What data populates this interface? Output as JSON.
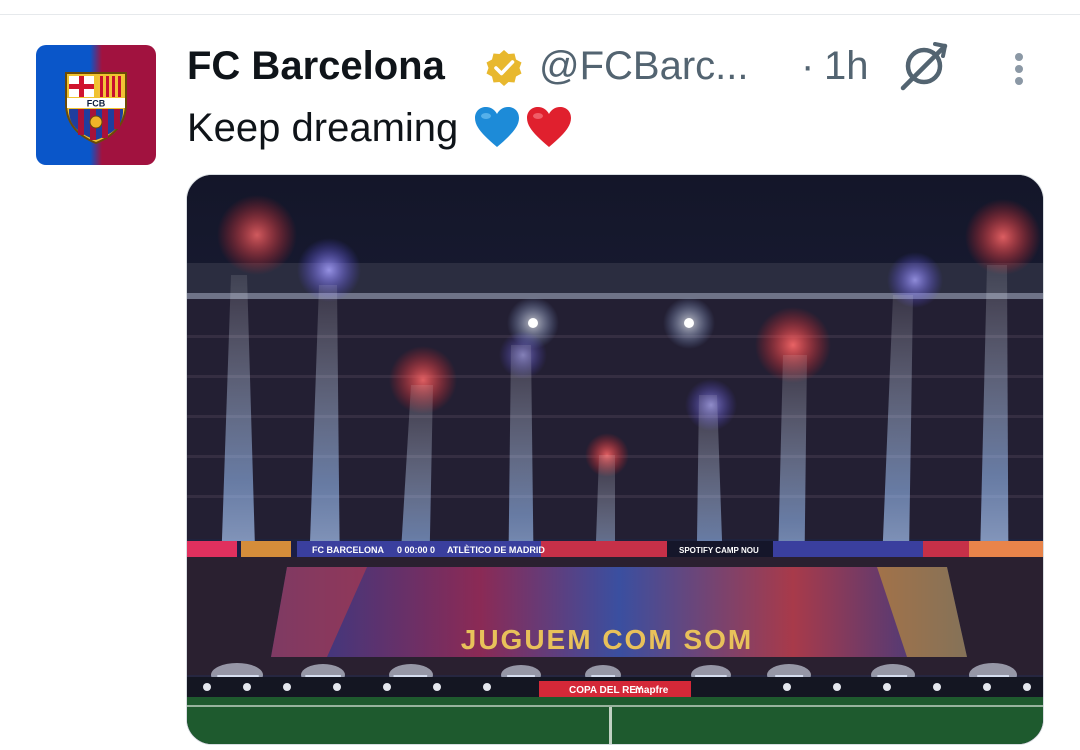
{
  "tweet": {
    "author_name": "FC Barcelona",
    "handle": "@FCBarc...",
    "separator": "·",
    "time": "1h",
    "text": "Keep dreaming",
    "emojis": [
      "blue-heart",
      "red-heart"
    ],
    "verified": true
  },
  "avatar": {
    "crest_text": "FCB"
  },
  "media": {
    "led_left": "FC BARCELONA",
    "led_score": "0  00:00  0",
    "led_right": "ATLÈTICO DE MADRID",
    "led_center": "SPOTIFY CAMP NOU",
    "tifo_text": "JUGUEM COM SOM",
    "board_left": "COPA DEL REY",
    "board_right": "mapfre"
  },
  "colors": {
    "text_primary": "#0f1419",
    "text_secondary": "#536471",
    "verified_gold": "#e8b82e",
    "barca_blue": "#0a56c9",
    "barca_red": "#a1123f"
  }
}
